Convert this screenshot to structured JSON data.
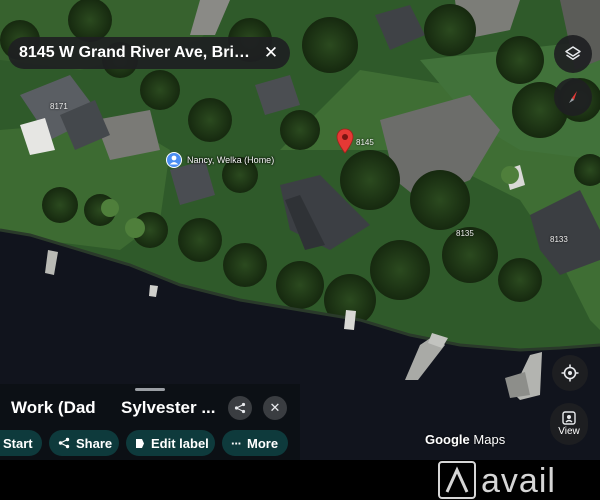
{
  "search": {
    "text": "8145 W Grand River Ave, Brig..."
  },
  "map": {
    "pin_label": "8145",
    "home_label": "Nancy, Welka (Home)",
    "house_numbers": {
      "h8171": "8171",
      "h8135": "8135",
      "h8133": "8133"
    },
    "attribution_google": "Google",
    "attribution_maps": "Maps",
    "pin_color": "#e53935",
    "home_pin_color": "#4a8ef2"
  },
  "sheet": {
    "card_work": "Work (Dad",
    "card_sylvester": "Sylvester ...",
    "chips": {
      "start": "Start",
      "share": "Share",
      "edit_label": "Edit label",
      "more": "More"
    }
  },
  "controls": {
    "view_label": "View"
  },
  "watermark": {
    "text": "avail"
  },
  "icons": {
    "search_close": "close-icon",
    "layers": "layers-icon",
    "compass": "compass-icon",
    "my_location": "my-location-icon",
    "street_view": "street-view-icon",
    "share": "share-icon",
    "bookmark": "label-icon",
    "more": "more-dots-icon"
  },
  "colors": {
    "chip_bg": "#0e3a3c",
    "water": "#11141d",
    "grass": "#2f5a2a"
  }
}
